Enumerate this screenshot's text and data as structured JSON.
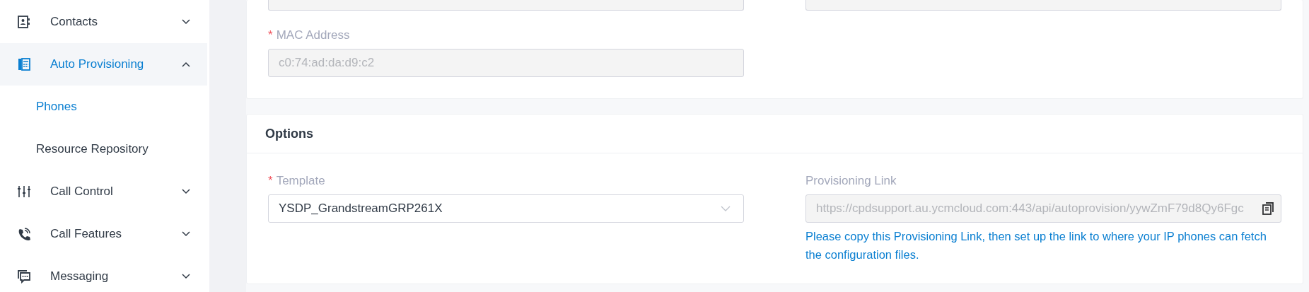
{
  "sidebar": {
    "items": [
      {
        "label": "Contacts",
        "expanded": false,
        "selected": false
      },
      {
        "label": "Auto Provisioning",
        "expanded": true,
        "selected": true,
        "children": [
          {
            "label": "Phones",
            "selected": true
          },
          {
            "label": "Resource Repository",
            "selected": false
          }
        ]
      },
      {
        "label": "Call Control",
        "expanded": false,
        "selected": false
      },
      {
        "label": "Call Features",
        "expanded": false,
        "selected": false
      },
      {
        "label": "Messaging",
        "expanded": false,
        "selected": false
      }
    ]
  },
  "device_card": {
    "cut_fields": [
      {
        "disabled": true
      },
      {
        "disabled": true
      }
    ],
    "fields": [
      {
        "label": "MAC Address",
        "required_mark": "*",
        "kind": "text",
        "value": "c0:74:ad:da:d9:c2",
        "disabled": true
      }
    ]
  },
  "options_card": {
    "title": "Options",
    "fields": [
      {
        "label": "Template",
        "required_mark": "*",
        "kind": "select",
        "value": "YSDP_GrandstreamGRP261X",
        "disabled": false
      },
      {
        "label": "Provisioning Link",
        "kind": "copy",
        "value": "https://cpdsupport.au.ycmcloud.com:443/api/autoprovision/yywZmF79d8Qy6Fgc",
        "disabled": true,
        "help": "Please copy this Provisioning Link, then set up the link to where your IP phones can fetch the configuration files."
      }
    ]
  }
}
